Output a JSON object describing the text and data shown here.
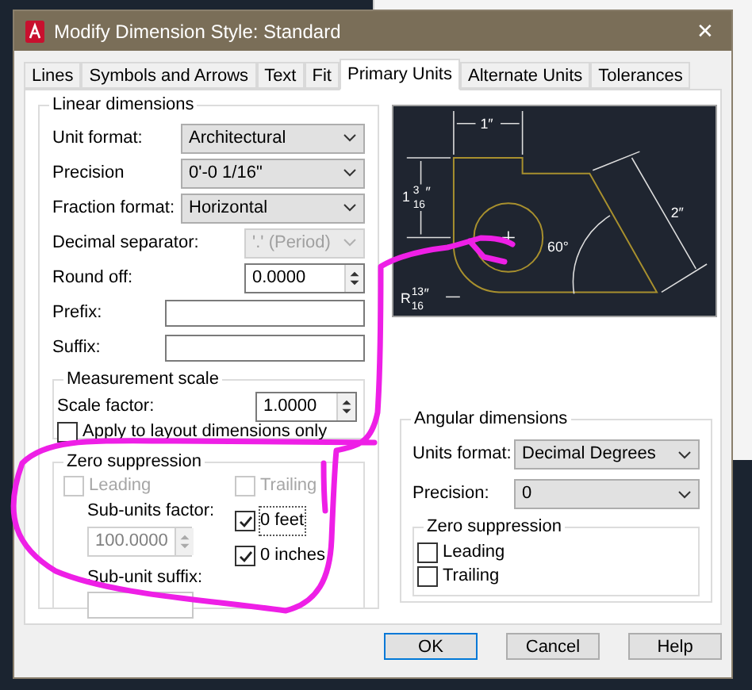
{
  "window": {
    "title": "Modify Dimension Style: Standard",
    "close": "✕"
  },
  "tabs": [
    {
      "label": "Lines",
      "selected": false
    },
    {
      "label": "Symbols and Arrows",
      "selected": false
    },
    {
      "label": "Text",
      "selected": false
    },
    {
      "label": "Fit",
      "selected": false
    },
    {
      "label": "Primary Units",
      "selected": true
    },
    {
      "label": "Alternate Units",
      "selected": false
    },
    {
      "label": "Tolerances",
      "selected": false
    }
  ],
  "linear_dimensions": {
    "title": "Linear dimensions",
    "fields": [
      {
        "kind": "combo",
        "label": "Unit format:",
        "value": "Architectural",
        "disabled": false
      },
      {
        "kind": "combo",
        "label": "Precision",
        "value": "0'-0 1/16\"",
        "disabled": false
      },
      {
        "kind": "combo",
        "label": "Fraction format:",
        "value": "Horizontal",
        "disabled": false
      },
      {
        "kind": "combo",
        "label": "Decimal separator:",
        "value": "'.' (Period)",
        "disabled": true
      },
      {
        "kind": "spinner",
        "label": "Round off:",
        "value": "0.0000",
        "disabled": false
      },
      {
        "kind": "text",
        "label": "Prefix:"
      },
      {
        "kind": "text",
        "label": "Suffix:"
      }
    ],
    "measurement_scale": {
      "title": "Measurement scale",
      "scale_factor": {
        "label": "Scale factor:",
        "value": "1.0000"
      },
      "apply_layout": {
        "label": "Apply to layout dimensions only",
        "checked": false
      }
    },
    "zero_suppression": {
      "title": "Zero suppression",
      "leading": {
        "label": "Leading",
        "checked": false,
        "disabled": true
      },
      "trailing": {
        "label": "Trailing",
        "checked": false,
        "disabled": true
      },
      "sub_units_factor": {
        "label": "Sub-units factor:",
        "value": "100.0000",
        "disabled": true
      },
      "feet": {
        "label": "0 feet",
        "checked": true
      },
      "inches": {
        "label": "0 inches",
        "checked": true
      },
      "sub_unit_suffix": {
        "label": "Sub-unit suffix:"
      }
    }
  },
  "preview": {
    "top_dim": "1″",
    "left_dim": {
      "whole": "1",
      "num": "3",
      "den": "16",
      "mark": "″"
    },
    "slant_dim": "2″",
    "angle_dim": "60°",
    "radius_dim": {
      "whole": "R",
      "num": "13",
      "den": "16",
      "mark": "″"
    }
  },
  "angular_dimensions": {
    "title": "Angular dimensions",
    "fields": [
      {
        "label": "Units format:",
        "value": "Decimal Degrees"
      },
      {
        "label": "Precision:",
        "value": "0"
      }
    ],
    "zero_suppression": {
      "title": "Zero suppression",
      "options": [
        {
          "label": "Leading",
          "checked": false
        },
        {
          "label": "Trailing",
          "checked": false
        }
      ]
    }
  },
  "buttons": [
    {
      "label": "OK",
      "default": true
    },
    {
      "label": "Cancel",
      "default": false
    },
    {
      "label": "Help",
      "default": false
    }
  ]
}
